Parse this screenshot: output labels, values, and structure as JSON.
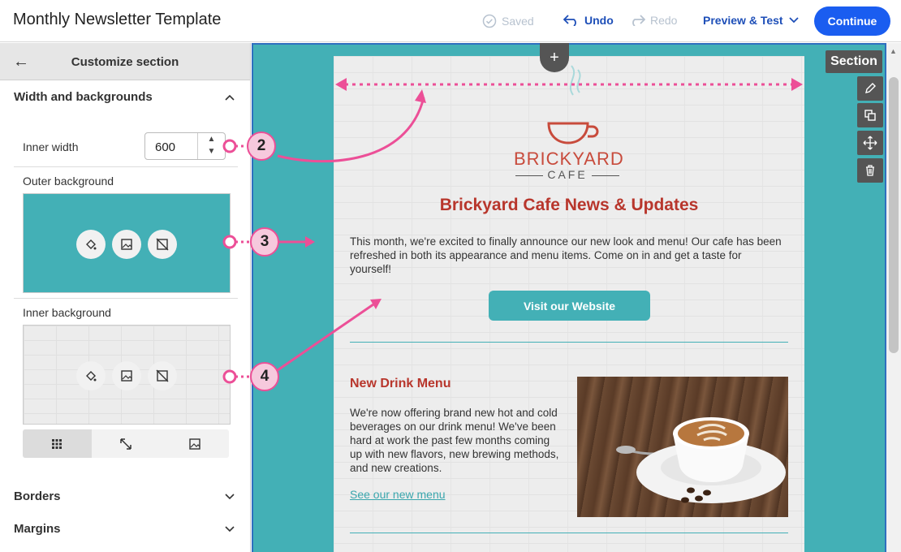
{
  "header": {
    "title": "Monthly Newsletter Template",
    "saved": "Saved",
    "undo": "Undo",
    "redo": "Redo",
    "preview": "Preview & Test",
    "continue": "Continue"
  },
  "sidebar": {
    "title": "Customize section",
    "section1": "Width and backgrounds",
    "inner_width_label": "Inner width",
    "inner_width_value": "600",
    "outer_bg_label": "Outer background",
    "inner_bg_label": "Inner background",
    "borders": "Borders",
    "margins": "Margins"
  },
  "canvas": {
    "section_tag": "Section",
    "logo_name": "BRICKYARD",
    "logo_sub": "CAFE",
    "email_title": "Brickyard Cafe News & Updates",
    "intro": "This month, we're excited to finally announce our new look and menu! Our cafe has been refreshed in both its appearance and menu items. Come on in and get a taste for yourself!",
    "cta": "Visit our Website",
    "drink_title": "New Drink Menu",
    "drink_body": "We're now offering brand new hot and cold beverages on our drink menu! We've been hard at work the past few months coming up with new flavors, new brewing methods, and new creations.",
    "drink_link": "See our new menu"
  },
  "callouts": [
    "2",
    "3",
    "4"
  ],
  "colors": {
    "accent": "#1a5df0",
    "teal": "#43b0b6",
    "brand_red": "#b8362c",
    "callout": "#ec4f97"
  }
}
